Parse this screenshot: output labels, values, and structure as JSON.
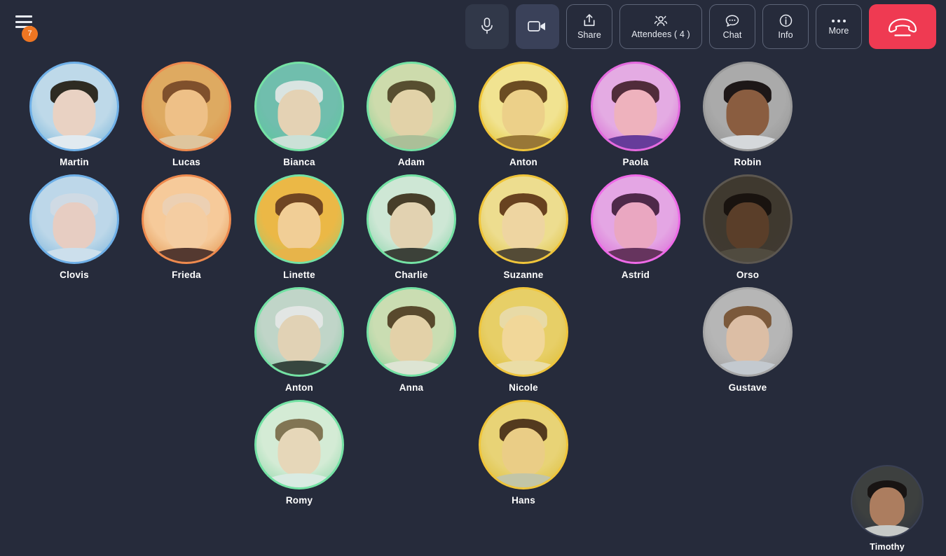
{
  "app": {
    "background_color": "#262b3b",
    "accent_danger": "#ef3a52",
    "accent_badge": "#ef7622"
  },
  "header": {
    "menu": {
      "icon": "hamburger-icon",
      "badge_count": "7",
      "badge_color": "#ef7622"
    },
    "buttons": [
      {
        "id": "mic",
        "icon": "microphone-icon",
        "label": "",
        "style": "filled-dark",
        "bg": "#313849"
      },
      {
        "id": "camera",
        "icon": "video-camera-icon",
        "label": "",
        "style": "filled-light",
        "bg": "#3a4159"
      },
      {
        "id": "share",
        "icon": "share-upload-icon",
        "label": "Share",
        "style": "outline",
        "bg": "transparent"
      },
      {
        "id": "attendees",
        "icon": "people-icon",
        "label": "Attendees ( 4 )",
        "style": "outline",
        "bg": "transparent"
      },
      {
        "id": "chat",
        "icon": "chat-bubble-icon",
        "label": "Chat",
        "style": "outline",
        "bg": "transparent"
      },
      {
        "id": "info",
        "icon": "info-circle-icon",
        "label": "Info",
        "style": "outline",
        "bg": "transparent"
      },
      {
        "id": "more",
        "icon": "ellipsis-icon",
        "label": "More",
        "style": "outline",
        "bg": "transparent"
      },
      {
        "id": "hangup",
        "icon": "hang-up-phone-icon",
        "label": "",
        "style": "danger",
        "bg": "#ef3a52"
      }
    ],
    "attendees_count": "4"
  },
  "gallery": {
    "columns": 7,
    "column_x": [
      26,
      186,
      347,
      507,
      667,
      827,
      987
    ],
    "rows": [
      {
        "row": 1,
        "participants": [
          {
            "col": 1,
            "name": "Martin",
            "ring": "#6fb0e8",
            "tint": "#8fb9dd",
            "skin": "#e8c39b",
            "hair": "#2b2218",
            "shirt": "#dfe3e6",
            "bg": "#b9cddb"
          },
          {
            "col": 2,
            "name": "Lucas",
            "ring": "#ee8a4e",
            "tint": "#e0a36a",
            "skin": "#e3b591",
            "hair": "#5a4530",
            "shirt": "#c8bba6",
            "bg": "#c79a6b"
          },
          {
            "col": 3,
            "name": "Bianca",
            "ring": "#74e2a4",
            "tint": "#6fb8a6",
            "skin": "#e6c4a6",
            "hair": "#dcdcdc",
            "shirt": "#cfd8cf",
            "bg": "#78a99d"
          },
          {
            "col": 4,
            "name": "Adam",
            "ring": "#74e2a4",
            "tint": "#a8c294",
            "skin": "#dcc0a0",
            "hair": "#4a3c2c",
            "shirt": "#9aa58e",
            "bg": "#c3cda4"
          },
          {
            "col": 5,
            "name": "Anton",
            "ring": "#f0c53a",
            "tint": "#e3c66b",
            "skin": "#dfbc92",
            "hair": "#4b3a26",
            "shirt": "#6a5b3c",
            "bg": "#e8d79a"
          },
          {
            "col": 6,
            "name": "Paola",
            "ring": "#e56ae0",
            "tint": "#d786d6",
            "skin": "#e5b096",
            "hair": "#3a2a2a",
            "shirt": "#4a3a70",
            "bg": "#d4a8d2"
          },
          {
            "col": 7,
            "name": "Robin",
            "ring": "#9a9a9a",
            "tint": "#9e9e9e",
            "skin": "#7a5238",
            "hair": "#191414",
            "shirt": "#cfd2d6",
            "bg": "#9d9d9d"
          }
        ]
      },
      {
        "row": 2,
        "participants": [
          {
            "col": 1,
            "name": "Clovis",
            "ring": "#6fb0e8",
            "tint": "#9cc0de",
            "skin": "#e4bb98",
            "hair": "#c9cdd2",
            "shirt": "#c5d4df",
            "bg": "#b4c9da"
          },
          {
            "col": 2,
            "name": "Frieda",
            "ring": "#ee8a4e",
            "tint": "#e8a87d",
            "skin": "#ecc3a3",
            "hair": "#ddc6b4",
            "shirt": "#3a3030",
            "bg": "#efbf9b"
          },
          {
            "col": 3,
            "name": "Linette",
            "ring": "#74e2a4",
            "tint": "#dda95a",
            "skin": "#e8c4a4",
            "hair": "#4f3a28",
            "shirt": "#d8a457",
            "bg": "#dfa953"
          },
          {
            "col": 4,
            "name": "Charlie",
            "ring": "#74e2a4",
            "tint": "#a9cfb4",
            "skin": "#dcbb9a",
            "hair": "#3c2e22",
            "shirt": "#33302e",
            "bg": "#c3dbc9"
          },
          {
            "col": 5,
            "name": "Suzanne",
            "ring": "#f0c53a",
            "tint": "#dcc57e",
            "skin": "#e4c3a2",
            "hair": "#4a3320",
            "shirt": "#3c3a36",
            "bg": "#e2cf90"
          },
          {
            "col": 6,
            "name": "Astrid",
            "ring": "#ef6ae8",
            "tint": "#d083cf",
            "skin": "#e0a6a0",
            "hair": "#3a2836",
            "shirt": "#4c3346",
            "bg": "#d7a5d6"
          },
          {
            "col": 7,
            "name": "Orso",
            "ring": "#5c5750",
            "tint": "#5d564c",
            "skin": "#6a4b34",
            "hair": "#1d1713",
            "shirt": "#5e5a51",
            "bg": "#4a443c"
          }
        ]
      },
      {
        "row": 3,
        "participants": [
          {
            "col": 3,
            "name": "Anton",
            "ring": "#74e2a4",
            "tint": "#a6c2ae",
            "skin": "#dcc0a2",
            "hair": "#dddddd",
            "shirt": "#2f3634",
            "bg": "#b4c4ba"
          },
          {
            "col": 4,
            "name": "Anna",
            "ring": "#74e2a4",
            "tint": "#a9c49a",
            "skin": "#ddbe9d",
            "hair": "#4a3828",
            "shirt": "#d6d9ce",
            "bg": "#bfcfa8"
          },
          {
            "col": 5,
            "name": "Nicole",
            "ring": "#f0c53a",
            "tint": "#ddc06a",
            "skin": "#e8c9a2",
            "hair": "#d9cdae",
            "shirt": "#ddd0ae",
            "bg": "#d8bd72"
          },
          {
            "col": 7,
            "name": "Gustave",
            "ring": "#a6a6a6",
            "tint": "#a6a6a6",
            "skin": "#d6b193",
            "hair": "#6a4c32",
            "shirt": "#b8bfc6",
            "bg": "#a8a8a8"
          }
        ]
      },
      {
        "row": 4,
        "participants": [
          {
            "col": 3,
            "name": "Romy",
            "ring": "#74e2a4",
            "tint": "#b3d6b6",
            "skin": "#e0c0a4",
            "hair": "#6a5544",
            "shirt": "#cfe0da",
            "bg": "#c8e0c8"
          },
          {
            "col": 5,
            "name": "Hans",
            "ring": "#f0c53a",
            "tint": "#dcc06e",
            "skin": "#dcba8e",
            "hair": "#3b2d20",
            "shirt": "#9ab0ad",
            "bg": "#d9c37f"
          }
        ]
      }
    ]
  },
  "selfview": {
    "name": "Timothy",
    "ring": "#3a4054",
    "tint": "#555f6c",
    "skin": "#b98d67",
    "hair": "#1d1714",
    "shirt": "#cfd0cb",
    "bg": "#4a4a44"
  }
}
